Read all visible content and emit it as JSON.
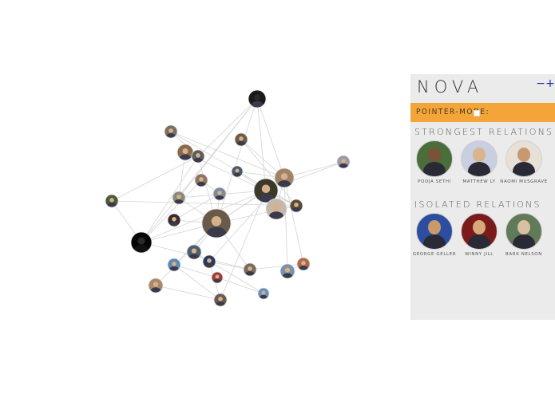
{
  "app": {
    "title": "NOVA",
    "zoom_out": "−",
    "zoom_in": "+"
  },
  "pointer_mode": {
    "label": "POINTER-MODE:",
    "checked": false
  },
  "strongest": {
    "title": "STRONGEST RELATIONS",
    "people": [
      {
        "name": "POOJA SETHI",
        "bg": "#4a6d3a",
        "face": "#7a5238"
      },
      {
        "name": "MATTHEW LY",
        "bg": "#c7cfe0",
        "face": "#d9b48c"
      },
      {
        "name": "NAOMI MUSGRAVE",
        "bg": "#e8e0d6",
        "face": "#c89870"
      }
    ]
  },
  "isolated": {
    "title": "ISOLATED RELATIONS",
    "people": [
      {
        "name": "GEORGE GELLER",
        "bg": "#2d4ea0",
        "face": "#c89a6c"
      },
      {
        "name": "WINNY JILL",
        "bg": "#7a1a1a",
        "face": "#d8a878"
      },
      {
        "name": "BARK NELSON",
        "bg": "#607a5a",
        "face": "#d8c0a0"
      }
    ]
  },
  "graph": {
    "nodes": [
      {
        "id": 0,
        "label": "",
        "color": "#1a1a1a"
      },
      {
        "id": 1,
        "label": "",
        "color": "#7a6e62"
      },
      {
        "id": 2,
        "label": "",
        "color": "#8a6a4c"
      },
      {
        "id": 3,
        "label": "",
        "color": "#5d5d5d"
      },
      {
        "id": 4,
        "label": "",
        "color": "#6b5a48"
      },
      {
        "id": 5,
        "label": "",
        "color": "#9a9aa8"
      },
      {
        "id": 6,
        "label": "",
        "color": "#8c7464"
      },
      {
        "id": 7,
        "label": "",
        "color": "#4a5a6a"
      },
      {
        "id": 8,
        "label": "",
        "color": "#8a8a7a"
      },
      {
        "id": 9,
        "label": "",
        "color": "#7c8aa0"
      },
      {
        "id": 10,
        "label": "",
        "color": "#3a3a2a"
      },
      {
        "id": 11,
        "label": "",
        "color": "#a08468"
      },
      {
        "id": 12,
        "label": "",
        "color": "#c5b8a8"
      },
      {
        "id": 13,
        "label": "",
        "color": "#5a4a3a"
      },
      {
        "id": 14,
        "label": "",
        "color": "#4a5a3a"
      },
      {
        "id": 15,
        "label": "",
        "color": "#3a2a28"
      },
      {
        "id": 16,
        "label": "",
        "color": "#6a5a4a"
      },
      {
        "id": 17,
        "label": "",
        "color": "#4a6070"
      },
      {
        "id": 18,
        "label": "",
        "color": "#050505"
      },
      {
        "id": 19,
        "label": "",
        "color": "#2a3a5a"
      },
      {
        "id": 20,
        "label": "",
        "color": "#5a8ab0"
      },
      {
        "id": 21,
        "label": "",
        "color": "#7a6a5a"
      },
      {
        "id": 22,
        "label": "",
        "color": "#b06a4a"
      },
      {
        "id": 23,
        "label": "",
        "color": "#a03a3a"
      },
      {
        "id": 24,
        "label": "",
        "color": "#7a90b0"
      },
      {
        "id": 25,
        "label": "",
        "color": "#a88a6a"
      },
      {
        "id": 26,
        "label": "",
        "color": "#6a5a50"
      },
      {
        "id": 27,
        "label": "",
        "color": "#6a90c0"
      },
      {
        "id": 28,
        "label": "",
        "color": "#d8d8d8"
      }
    ],
    "edges": [
      [
        0,
        3
      ],
      [
        0,
        11
      ],
      [
        0,
        10
      ],
      [
        0,
        16
      ],
      [
        0,
        8
      ],
      [
        0,
        18
      ],
      [
        1,
        3
      ],
      [
        1,
        13
      ],
      [
        1,
        11
      ],
      [
        2,
        3
      ],
      [
        2,
        13
      ],
      [
        2,
        8
      ],
      [
        3,
        18
      ],
      [
        3,
        14
      ],
      [
        3,
        16
      ],
      [
        4,
        11
      ],
      [
        4,
        13
      ],
      [
        5,
        10
      ],
      [
        5,
        11
      ],
      [
        6,
        18
      ],
      [
        6,
        9
      ],
      [
        7,
        11
      ],
      [
        7,
        10
      ],
      [
        8,
        10
      ],
      [
        8,
        16
      ],
      [
        9,
        16
      ],
      [
        10,
        11
      ],
      [
        10,
        16
      ],
      [
        10,
        13
      ],
      [
        10,
        18
      ],
      [
        11,
        16
      ],
      [
        11,
        19
      ],
      [
        11,
        24
      ],
      [
        11,
        22
      ],
      [
        12,
        13
      ],
      [
        12,
        11
      ],
      [
        13,
        16
      ],
      [
        13,
        14
      ],
      [
        15,
        16
      ],
      [
        16,
        18
      ],
      [
        16,
        17
      ],
      [
        16,
        21
      ],
      [
        16,
        20
      ],
      [
        16,
        25
      ],
      [
        17,
        19
      ],
      [
        18,
        14
      ],
      [
        19,
        21
      ],
      [
        20,
        23
      ],
      [
        21,
        22
      ],
      [
        22,
        24
      ],
      [
        23,
        27
      ],
      [
        24,
        28
      ],
      [
        25,
        26
      ],
      [
        26,
        10
      ],
      [
        17,
        27
      ],
      [
        18,
        21
      ],
      [
        19,
        26
      ],
      [
        20,
        26
      ],
      [
        15,
        9
      ]
    ]
  }
}
